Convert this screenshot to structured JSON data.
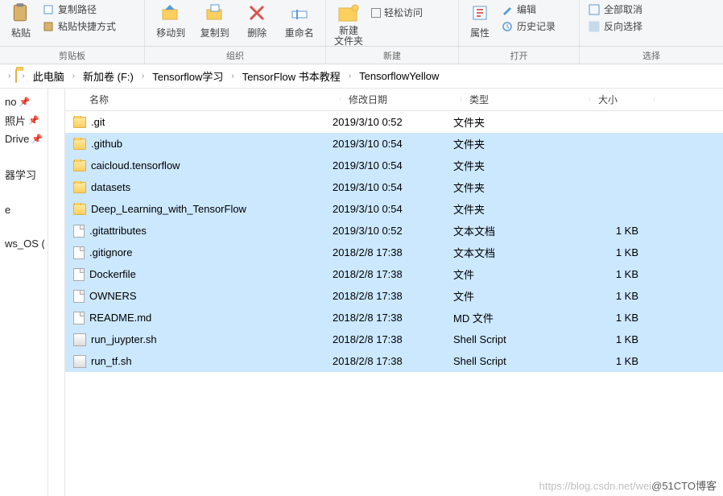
{
  "ribbon": {
    "clipboard": {
      "paste": "粘贴",
      "copyPath": "复制路径",
      "pasteShortcut": "粘贴快捷方式",
      "label": "剪贴板"
    },
    "organize": {
      "moveTo": "移动到",
      "copyTo": "复制到",
      "delete": "删除",
      "rename": "重命名",
      "label": "组织"
    },
    "new": {
      "newFolder": "新建\n文件夹",
      "easyAccess": "轻松访问",
      "label": "新建"
    },
    "open": {
      "properties": "属性",
      "edit": "编辑",
      "history": "历史记录",
      "label": "打开"
    },
    "select": {
      "allCancel": "全部取消",
      "invert": "反向选择",
      "label": "选择"
    }
  },
  "breadcrumb": {
    "root": "此电脑",
    "drive": "新加卷 (F:)",
    "p1": "Tensorflow学习",
    "p2": "TensorFlow  书本教程",
    "p3": "TensorflowYellow"
  },
  "sidebar": {
    "items": [
      {
        "label": "no",
        "pinned": true
      },
      {
        "label": "照片",
        "pinned": true
      },
      {
        "label": "Drive",
        "pinned": true
      },
      {
        "label": "",
        "pinned": false
      },
      {
        "label": "器学习",
        "pinned": false
      },
      {
        "label": "",
        "pinned": false
      },
      {
        "label": "e",
        "pinned": false
      },
      {
        "label": "",
        "pinned": false
      },
      {
        "label": "ws_OS (",
        "pinned": false
      }
    ]
  },
  "columns": {
    "name": "名称",
    "date": "修改日期",
    "type": "类型",
    "size": "大小"
  },
  "rows": [
    {
      "icon": "folder",
      "name": ".git",
      "date": "2019/3/10 0:52",
      "type": "文件夹",
      "size": "",
      "selected": false
    },
    {
      "icon": "folder",
      "name": ".github",
      "date": "2019/3/10 0:54",
      "type": "文件夹",
      "size": "",
      "selected": true
    },
    {
      "icon": "folder",
      "name": "caicloud.tensorflow",
      "date": "2019/3/10 0:54",
      "type": "文件夹",
      "size": "",
      "selected": true
    },
    {
      "icon": "folder",
      "name": "datasets",
      "date": "2019/3/10 0:54",
      "type": "文件夹",
      "size": "",
      "selected": true
    },
    {
      "icon": "folder",
      "name": "Deep_Learning_with_TensorFlow",
      "date": "2019/3/10 0:54",
      "type": "文件夹",
      "size": "",
      "selected": true
    },
    {
      "icon": "file",
      "name": ".gitattributes",
      "date": "2019/3/10 0:52",
      "type": "文本文档",
      "size": "1 KB",
      "selected": true
    },
    {
      "icon": "file",
      "name": ".gitignore",
      "date": "2018/2/8 17:38",
      "type": "文本文档",
      "size": "1 KB",
      "selected": true
    },
    {
      "icon": "file",
      "name": "Dockerfile",
      "date": "2018/2/8 17:38",
      "type": "文件",
      "size": "1 KB",
      "selected": true
    },
    {
      "icon": "file",
      "name": "OWNERS",
      "date": "2018/2/8 17:38",
      "type": "文件",
      "size": "1 KB",
      "selected": true
    },
    {
      "icon": "file",
      "name": "README.md",
      "date": "2018/2/8 17:38",
      "type": "MD 文件",
      "size": "1 KB",
      "selected": true
    },
    {
      "icon": "generic",
      "name": "run_juypter.sh",
      "date": "2018/2/8 17:38",
      "type": "Shell Script",
      "size": "1 KB",
      "selected": true
    },
    {
      "icon": "generic",
      "name": "run_tf.sh",
      "date": "2018/2/8 17:38",
      "type": "Shell Script",
      "size": "1 KB",
      "selected": true
    }
  ],
  "watermark": {
    "faint": "https://blog.csdn.net/wei",
    "dark": "@51CTO博客"
  }
}
